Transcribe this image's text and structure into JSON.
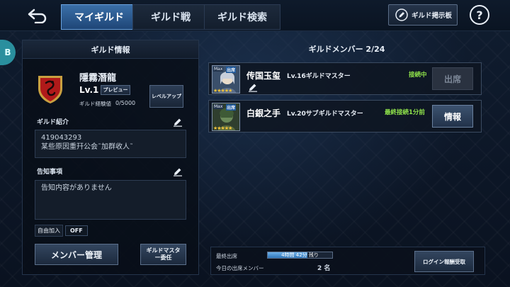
{
  "tabs": [
    {
      "label": "マイギルド",
      "active": true
    },
    {
      "label": "ギルド戦",
      "active": false
    },
    {
      "label": "ギルド検索",
      "active": false
    }
  ],
  "header": {
    "board_label": "ギルド掲示板",
    "help_label": "?",
    "side_handle_label": "B"
  },
  "guild_info": {
    "title": "ギルド情報",
    "name": "隱霧潛龍",
    "level": "Lv.1",
    "preview_label": "プレビュー",
    "levelup_label": "レベルアップ",
    "exp_label": "ギルド経験値",
    "exp_value": "0/5000",
    "intro_label": "ギルド紹介",
    "intro_lines": [
      "419043293",
      "某些原因重幵公会˜加群收人˜"
    ],
    "notice_label": "告知事項",
    "notice_text": "告知内容がありません",
    "free_join_label": "自由加入",
    "free_join_value": "OFF",
    "member_manage_label": "メンバー管理",
    "master_delegate_label": "ギルドマスター委任"
  },
  "members": {
    "title": "ギルドメンバー 2/24",
    "list": [
      {
        "name": "传国玉玺",
        "level_role": "Lv.16ギルドマスター",
        "status": "接続中",
        "button": "出席",
        "button_enabled": false,
        "badge": "出席",
        "max_label": "Max",
        "stars": "★★★★★",
        "editable": true
      },
      {
        "name": "白銀之手",
        "level_role": "Lv.20サブギルドマスター",
        "status": "最終接続1分前",
        "button": "情報",
        "button_enabled": true,
        "badge": "出席",
        "max_label": "Max",
        "stars": "★★★★★",
        "editable": false
      }
    ]
  },
  "attendance": {
    "last_label": "最終出席",
    "remaining_text": "4時間 42分 残り",
    "remaining_fraction": 0.62,
    "today_label": "今日の出席メンバー",
    "today_count": "2 名",
    "reward_button": "ログイン報酬受取"
  },
  "colors": {
    "accent_blue": "#3a6fa8",
    "online_green": "#8fe24a",
    "crest_red": "#b01a1a",
    "crest_gold": "#c9a040"
  },
  "icons": [
    "back-arrow-icon",
    "pencil-icon",
    "help-icon",
    "edit-icon",
    "guild-crest-icon"
  ]
}
